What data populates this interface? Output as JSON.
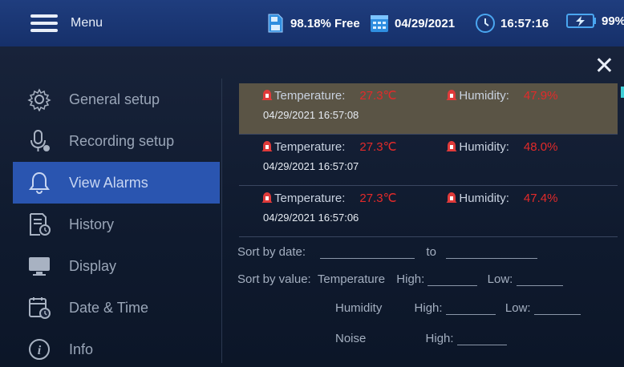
{
  "topbar": {
    "menu_label": "Menu",
    "storage": "98.18% Free",
    "date": "04/29/2021",
    "time": "16:57:16",
    "battery": "99%"
  },
  "sidebar": {
    "items": [
      {
        "label": "General setup",
        "icon": "gear-icon"
      },
      {
        "label": "Recording setup",
        "icon": "microphone-icon"
      },
      {
        "label": "View Alarms",
        "icon": "bell-icon",
        "active": true
      },
      {
        "label": "History",
        "icon": "history-icon"
      },
      {
        "label": "Display",
        "icon": "monitor-icon"
      },
      {
        "label": "Date & Time",
        "icon": "calendar-clock-icon"
      },
      {
        "label": "Info",
        "icon": "info-icon"
      }
    ]
  },
  "alarms": [
    {
      "temp_label": "Temperature:",
      "temp_value": "27.3℃",
      "hum_label": "Humidity:",
      "hum_value": "47.9%",
      "datetime": "04/29/2021 16:57:08",
      "selected": true
    },
    {
      "temp_label": "Temperature:",
      "temp_value": "27.3℃",
      "hum_label": "Humidity:",
      "hum_value": "48.0%",
      "datetime": "04/29/2021 16:57:07"
    },
    {
      "temp_label": "Temperature:",
      "temp_value": "27.3℃",
      "hum_label": "Humidity:",
      "hum_value": "47.4%",
      "datetime": "04/29/2021 16:57:06"
    }
  ],
  "sort": {
    "by_date_label": "Sort by date:",
    "to_label": "to",
    "by_value_label": "Sort by value:",
    "temperature_label": "Temperature",
    "humidity_label": "Humidity",
    "noise_label": "Noise",
    "high_label": "High:",
    "low_label": "Low:"
  },
  "colors": {
    "topbar": "#1f3d7e",
    "active_item": "#2a55b0",
    "alarm_value": "#e22a2a",
    "selected_row": "#5a5445"
  }
}
